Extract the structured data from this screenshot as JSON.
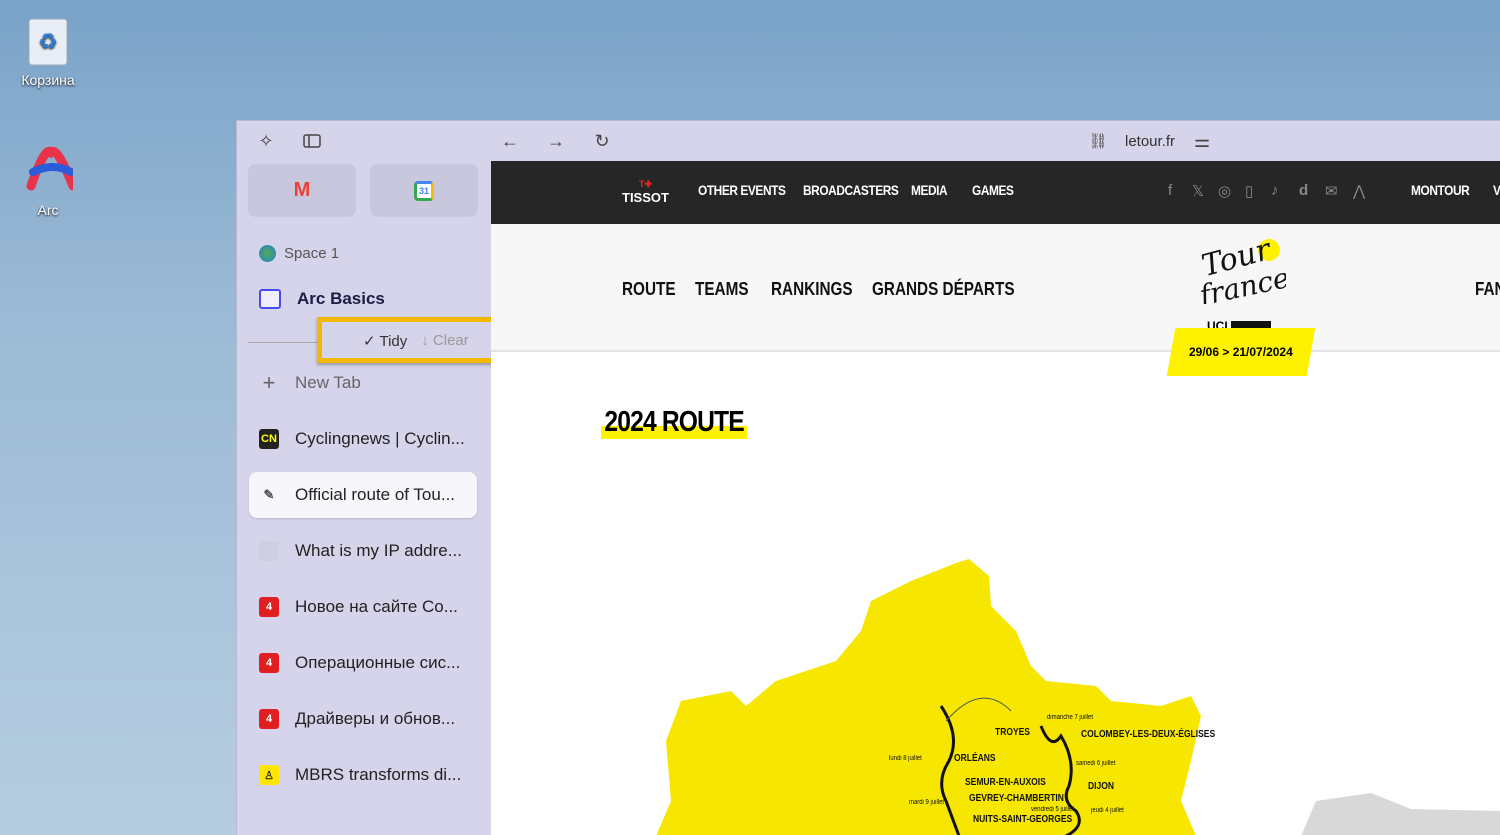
{
  "desktop": {
    "icons": [
      {
        "label": "Корзина",
        "icon": "recycle-bin-icon"
      },
      {
        "label": "Arc",
        "icon": "arc-icon"
      }
    ]
  },
  "browser": {
    "url": "letour.fr",
    "sidebar": {
      "pinned": [
        {
          "name": "Gmail",
          "icon": "gmail-icon"
        },
        {
          "name": "Google Calendar",
          "icon": "calendar-icon",
          "badge": "31"
        }
      ],
      "space": "Space 1",
      "folder": "Arc Basics",
      "tidy": "Tidy",
      "clear": "Clear",
      "new_tab": "New Tab",
      "tabs": [
        {
          "title": "Cyclingnews | Cyclin...",
          "icon": "CN",
          "selected": false
        },
        {
          "title": "Official route of Tou...",
          "icon": "tdf",
          "selected": true
        },
        {
          "title": "What is my IP addre...",
          "icon": "",
          "selected": false
        },
        {
          "title": "Новое на сайте Co...",
          "icon": "4",
          "selected": false
        },
        {
          "title": "Операционные сис...",
          "icon": "4",
          "selected": false
        },
        {
          "title": "Драйверы и обнов...",
          "icon": "4",
          "selected": false
        },
        {
          "title": "MBRS transforms di...",
          "icon": "bike",
          "selected": false
        }
      ]
    }
  },
  "site": {
    "top_links": [
      "OTHER EVENTS",
      "BROADCASTERS",
      "MEDIA",
      "GAMES"
    ],
    "sponsor": "TISSOT",
    "social": [
      "facebook",
      "x",
      "instagram",
      "phone",
      "tiktok",
      "dailymotion",
      "mail",
      "strava"
    ],
    "right_link": "MONTOUR",
    "right_cut": "V",
    "nav": [
      "ROUTE",
      "TEAMS",
      "RANKINGS",
      "GRANDS DÉPARTS"
    ],
    "nav_right": "FAN",
    "logo": "Tour de France",
    "uci": "UCI",
    "dates": "29/06 > 21/07/2024",
    "heading": "2024 ROUTE",
    "map_labels": [
      "TROYES",
      "COLOMBEY-LES-DEUX-ÉGLISES",
      "ORLÉANS",
      "SEMUR-EN-AUXOIS",
      "DIJON",
      "GEVREY-CHAMBERTIN",
      "NUITS-SAINT-GEORGES",
      "dimanche 7 juillet",
      "lundi 8 juillet",
      "samedi 6 juillet",
      "mardi 9 juillet",
      "vendredi 5 juillet",
      "jeudi 4 juillet"
    ]
  },
  "colors": {
    "accent": "#fff200",
    "highlight": "#f5b800",
    "sidebar": "#d5d4ea",
    "topbar": "#262626"
  }
}
